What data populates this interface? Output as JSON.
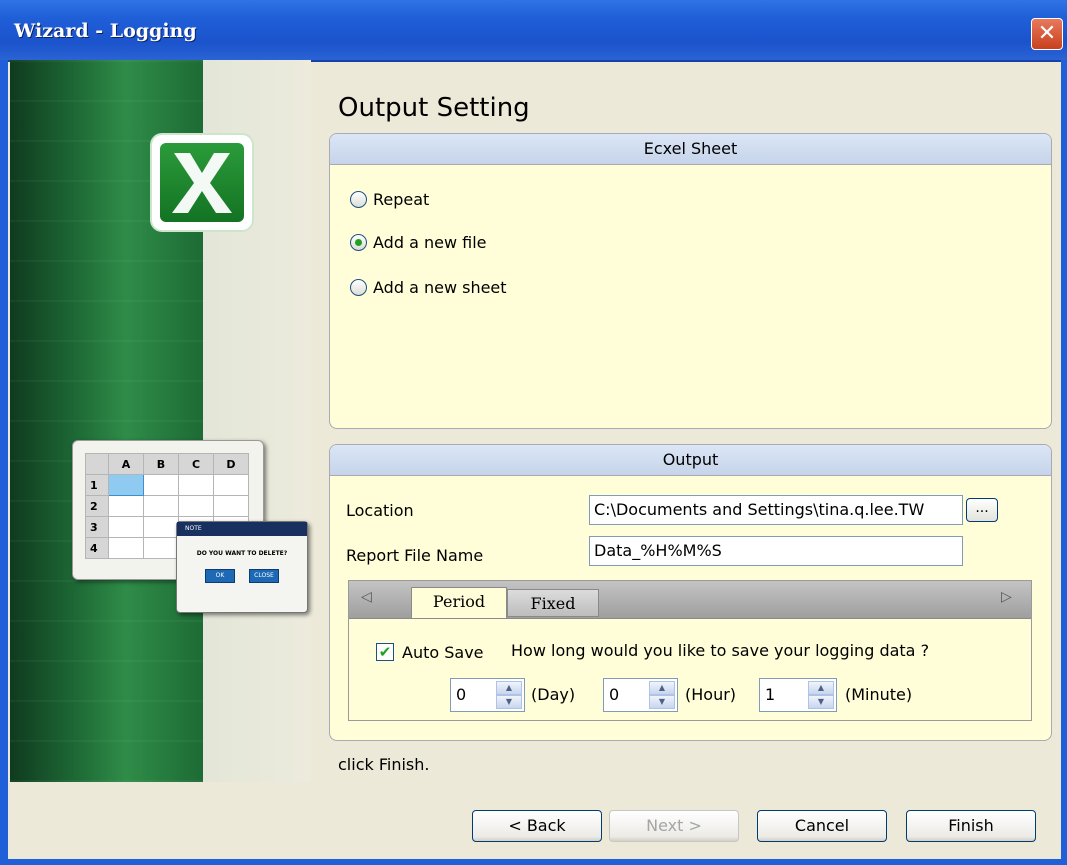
{
  "window": {
    "title": "Wizard - Logging",
    "close_glyph": "✕"
  },
  "page": {
    "title": "Output Setting",
    "hint": "click Finish."
  },
  "excel_sheet": {
    "header": "Ecxel Sheet",
    "options": [
      {
        "label": "Repeat",
        "selected": false
      },
      {
        "label": "Add a new file",
        "selected": true
      },
      {
        "label": "Add a new sheet",
        "selected": false
      }
    ]
  },
  "output": {
    "header": "Output",
    "location_label": "Location",
    "location_value": "C:\\Documents and Settings\\tina.q.lee.TW",
    "browse_label": "...",
    "report_label": "Report File Name",
    "report_value": "Data_%H%M%S"
  },
  "tabs": {
    "items": [
      "Period",
      "Fixed"
    ],
    "active": "Period",
    "left_arrow": "◁",
    "right_arrow": "▷"
  },
  "period": {
    "autosave_label": "Auto Save",
    "autosave_checked": true,
    "check_glyph": "✔",
    "question": "How long would you like to save your logging data ?",
    "day_value": "0",
    "day_label": "(Day)",
    "hour_value": "0",
    "hour_label": "(Hour)",
    "minute_value": "1",
    "minute_label": "(Minute)"
  },
  "buttons": {
    "back": "< Back",
    "next": "Next >",
    "cancel": "Cancel",
    "finish": "Finish"
  },
  "illustration": {
    "columns": [
      "A",
      "B",
      "C",
      "D"
    ],
    "rows": [
      "1",
      "2",
      "3",
      "4"
    ],
    "dialog_title": "NOTE",
    "dialog_message": "DO YOU WANT TO DELETE?",
    "dialog_ok": "OK",
    "dialog_close": "CLOSE"
  },
  "colors": {
    "title_bar": "#1f5fd8",
    "panel_bg": "#fffed8",
    "header_bg": "#c6d4ea",
    "radio_dot": "#21a121",
    "side_green": "#1e6a36"
  }
}
